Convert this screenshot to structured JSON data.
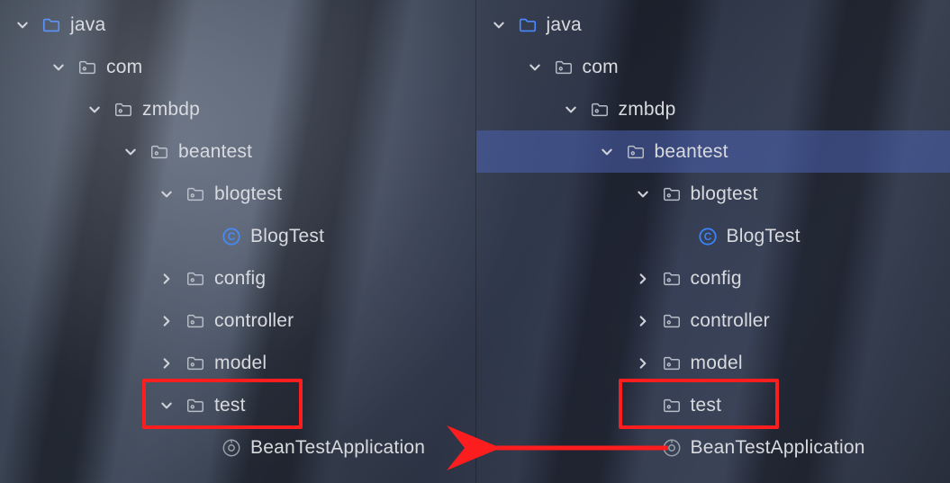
{
  "colors": {
    "highlight_box": "#fc1e1f",
    "folder_blue": "#4a88ff",
    "class_blue": "#3b82f6",
    "selection": "rgba(74,96,176,0.55)"
  },
  "left": {
    "rows": [
      {
        "depth": 0,
        "arrow": "down",
        "icon": "folder-blue",
        "label": "java"
      },
      {
        "depth": 1,
        "arrow": "down",
        "icon": "package",
        "label": "com"
      },
      {
        "depth": 2,
        "arrow": "down",
        "icon": "package",
        "label": "zmbdp"
      },
      {
        "depth": 3,
        "arrow": "down",
        "icon": "package",
        "label": "beantest"
      },
      {
        "depth": 4,
        "arrow": "down",
        "icon": "package",
        "label": "blogtest"
      },
      {
        "depth": 5,
        "arrow": "none",
        "icon": "class",
        "label": "BlogTest"
      },
      {
        "depth": 4,
        "arrow": "right",
        "icon": "package",
        "label": "config"
      },
      {
        "depth": 4,
        "arrow": "right",
        "icon": "package",
        "label": "controller"
      },
      {
        "depth": 4,
        "arrow": "right",
        "icon": "package",
        "label": "model"
      },
      {
        "depth": 4,
        "arrow": "down",
        "icon": "package",
        "label": "test",
        "boxed": true
      },
      {
        "depth": 5,
        "arrow": "none",
        "icon": "spring",
        "label": "BeanTestApplication"
      }
    ]
  },
  "right": {
    "rows": [
      {
        "depth": 0,
        "arrow": "down",
        "icon": "folder-blue",
        "label": "java"
      },
      {
        "depth": 1,
        "arrow": "down",
        "icon": "package",
        "label": "com"
      },
      {
        "depth": 2,
        "arrow": "down",
        "icon": "package",
        "label": "zmbdp"
      },
      {
        "depth": 3,
        "arrow": "down",
        "icon": "package",
        "label": "beantest",
        "selected": true
      },
      {
        "depth": 4,
        "arrow": "down",
        "icon": "package",
        "label": "blogtest"
      },
      {
        "depth": 5,
        "arrow": "none",
        "icon": "class",
        "label": "BlogTest"
      },
      {
        "depth": 4,
        "arrow": "right",
        "icon": "package",
        "label": "config"
      },
      {
        "depth": 4,
        "arrow": "right",
        "icon": "package",
        "label": "controller"
      },
      {
        "depth": 4,
        "arrow": "right",
        "icon": "package",
        "label": "model"
      },
      {
        "depth": 4,
        "arrow": "none",
        "icon": "package",
        "label": "test",
        "boxed": true
      },
      {
        "depth": 4,
        "arrow": "none",
        "icon": "spring",
        "label": "BeanTestApplication"
      }
    ]
  },
  "annotation": {
    "arrow_from_right_to_left": true
  }
}
